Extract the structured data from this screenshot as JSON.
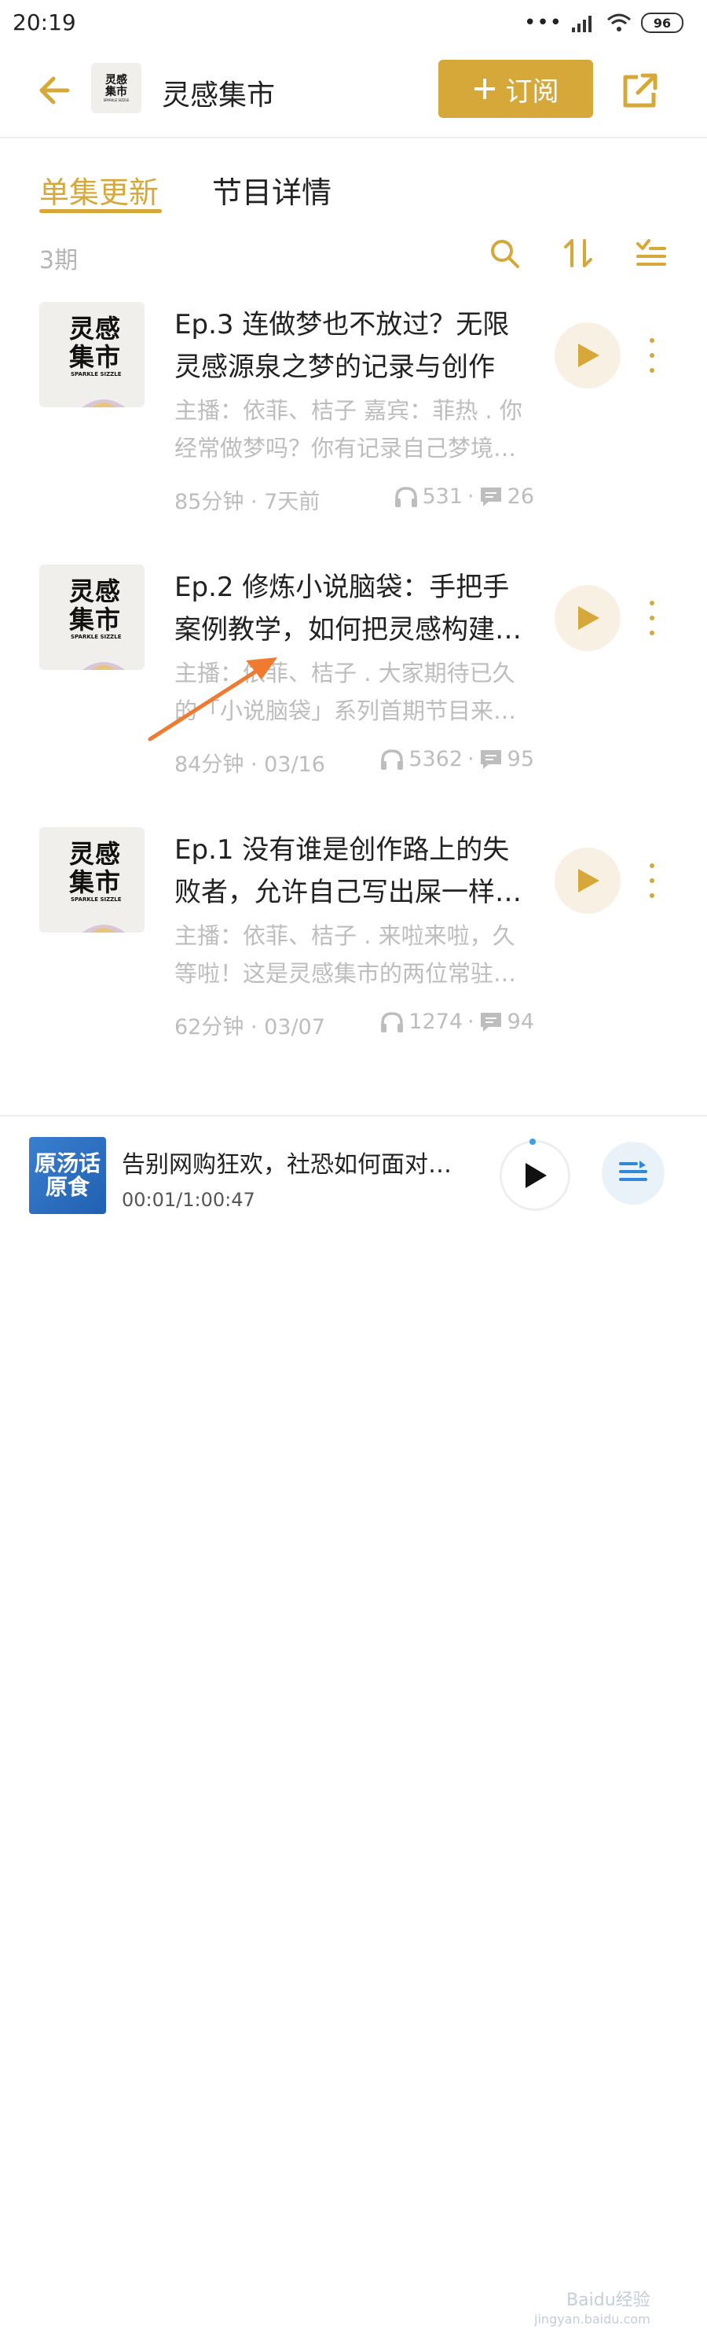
{
  "status_bar": {
    "time": "20:19",
    "battery": "96"
  },
  "header": {
    "title": "灵感集市",
    "subscribe_label": "订阅",
    "logo_line1": "灵感",
    "logo_line2": "集市",
    "logo_sub": "SPARKLE SIZZLE"
  },
  "tabs": [
    {
      "label": "单集更新",
      "active": true
    },
    {
      "label": "节目详情",
      "active": false
    }
  ],
  "toolbar": {
    "count": "3期"
  },
  "cover": {
    "line1": "灵感",
    "line2": "集市",
    "sub": "SPARKLE SIZZLE"
  },
  "episodes": [
    {
      "title": "Ep.3 连做梦也不放过？无限灵感源泉之梦的记录与创作",
      "desc": "主播：依菲、桔子 嘉宾：菲热 . 你经常做梦吗？你有记录自己梦境…",
      "meta": "85分钟 · 7天前",
      "plays": "531",
      "comments": "26"
    },
    {
      "title": "Ep.2 修炼小说脑袋：手把手案例教学，如何把灵感构建…",
      "desc": "主播：依菲、桔子 . 大家期待已久的「小说脑袋」系列首期节目来…",
      "meta": "84分钟 · 03/16",
      "plays": "5362",
      "comments": "95"
    },
    {
      "title": "Ep.1 没有谁是创作路上的失败者，允许自己写出屎一样…",
      "desc": "主播：依菲、桔子 . 来啦来啦，久等啦！这是灵感集市的两位常驻…",
      "meta": "62分钟 · 03/07",
      "plays": "1274",
      "comments": "94"
    }
  ],
  "mini_player": {
    "cover_text": "原汤话原食",
    "title": "告别网购狂欢，社恐如何面对…",
    "time": "00:01/1:00:47"
  },
  "watermark": {
    "line1": "Baidu经验",
    "line2": "jingyan.baidu.com"
  },
  "colors": {
    "accent": "#d6a83a",
    "annotation_arrow": "#f07a30"
  }
}
